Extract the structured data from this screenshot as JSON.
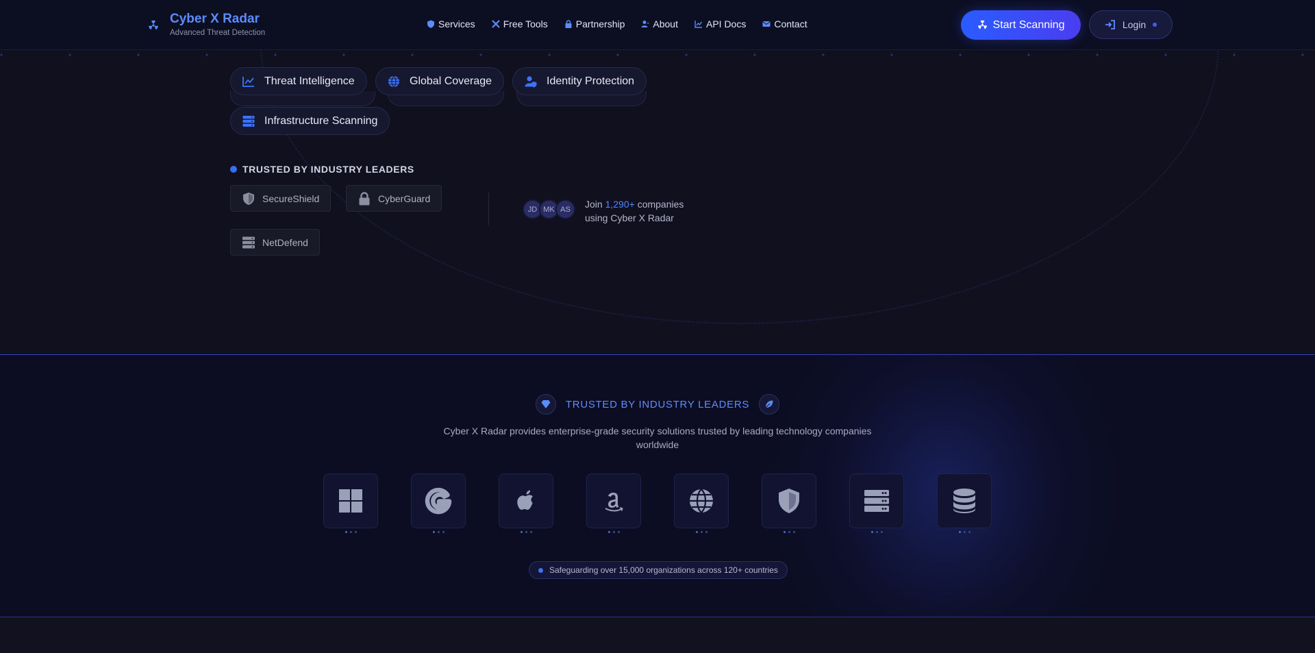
{
  "header": {
    "brand_title": "Cyber X Radar",
    "brand_subtitle": "Advanced Threat Detection",
    "brand_icon": "radiation-icon",
    "nav": [
      {
        "label": "Services",
        "icon": "shield-icon"
      },
      {
        "label": "Free Tools",
        "icon": "tools-icon"
      },
      {
        "label": "Partnership",
        "icon": "lock-icon"
      },
      {
        "label": "About",
        "icon": "user-icon"
      },
      {
        "label": "API Docs",
        "icon": "chart-icon"
      },
      {
        "label": "Contact",
        "icon": "envelope-icon"
      }
    ],
    "scan_button": "Start Scanning",
    "login_button": "Login"
  },
  "features": [
    {
      "label": "Threat Intelligence",
      "icon": "chart-line-icon"
    },
    {
      "label": "Global Coverage",
      "icon": "globe-icon"
    },
    {
      "label": "Identity Protection",
      "icon": "user-shield-icon"
    },
    {
      "label": "Infrastructure Scanning",
      "icon": "server-icon"
    }
  ],
  "trusted": {
    "heading": "TRUSTED BY INDUSTRY LEADERS",
    "partners": [
      {
        "name": "SecureShield",
        "icon": "shield-icon"
      },
      {
        "name": "CyberGuard",
        "icon": "lock-icon"
      },
      {
        "name": "NetDefend",
        "icon": "server-icon"
      }
    ],
    "avatars": [
      "JD",
      "MK",
      "AS"
    ],
    "join_prefix": "Join",
    "join_count": "1,290+",
    "join_suffix": "companies",
    "join_line2": "using Cyber X Radar"
  },
  "section2": {
    "title": "TRUSTED BY INDUSTRY LEADERS",
    "description": "Cyber X Radar provides enterprise-grade security solutions trusted by leading technology companies worldwide",
    "logos": [
      "windows-icon",
      "google-icon",
      "apple-icon",
      "amazon-icon",
      "globe-icon",
      "shield-icon",
      "server-icon",
      "database-icon"
    ],
    "footer_pill": "Safeguarding over 15,000 organizations across 120+ countries"
  },
  "colors": {
    "accent": "#5b8cff",
    "button_gradient_start": "#2a5cff",
    "button_gradient_end": "#4a3df0",
    "background": "#0f0f1c"
  }
}
